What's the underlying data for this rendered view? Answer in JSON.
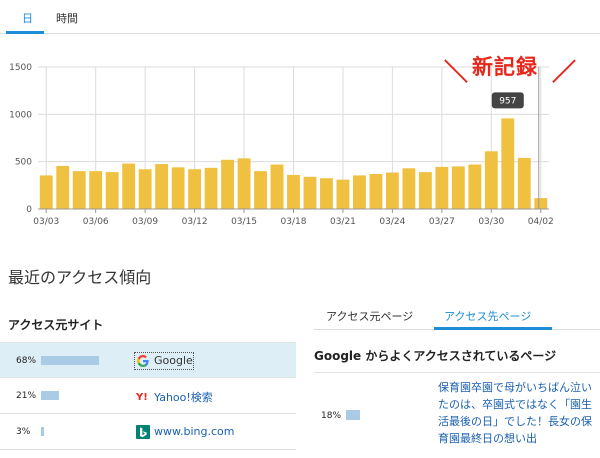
{
  "tabs": [
    {
      "label": "日",
      "active": true
    },
    {
      "label": "時間",
      "active": false
    }
  ],
  "annotation": {
    "slash_left": "＼",
    "text": "新記録",
    "slash_right": "／"
  },
  "chart_data": {
    "type": "bar",
    "categories": [
      "03/03",
      "03/04",
      "03/05",
      "03/06",
      "03/07",
      "03/08",
      "03/09",
      "03/10",
      "03/11",
      "03/12",
      "03/13",
      "03/14",
      "03/15",
      "03/16",
      "03/17",
      "03/18",
      "03/19",
      "03/20",
      "03/21",
      "03/22",
      "03/23",
      "03/24",
      "03/25",
      "03/26",
      "03/27",
      "03/28",
      "03/29",
      "03/30",
      "03/31",
      "04/01",
      "04/02"
    ],
    "values": [
      355,
      455,
      400,
      400,
      390,
      480,
      420,
      475,
      440,
      420,
      435,
      520,
      535,
      400,
      470,
      360,
      340,
      325,
      310,
      355,
      370,
      385,
      430,
      390,
      445,
      450,
      470,
      610,
      957,
      540,
      115
    ],
    "x_tick_labels": [
      "03/03",
      "03/06",
      "03/09",
      "03/12",
      "03/15",
      "03/18",
      "03/21",
      "03/24",
      "03/27",
      "03/30",
      "04/02"
    ],
    "y_tick_labels": [
      "0",
      "500",
      "1000",
      "1500"
    ],
    "ylim": [
      0,
      1500
    ],
    "tooltip": {
      "label": "957",
      "index": 28
    },
    "grid": true,
    "color": "#f0c040"
  },
  "section_title": "最近のアクセス傾向",
  "sources": {
    "heading": "アクセス元サイト",
    "rows": [
      {
        "pct": "68%",
        "fraction": 0.68,
        "icon": "google-icon",
        "label": "Google",
        "selected": true
      },
      {
        "pct": "21%",
        "fraction": 0.21,
        "icon": "yahoo-icon",
        "label": "Yahoo!検索",
        "selected": false
      },
      {
        "pct": "3%",
        "fraction": 0.03,
        "icon": "bing-icon",
        "label": "www.bing.com",
        "selected": false
      }
    ]
  },
  "right_tabs": [
    {
      "label": "アクセス元ページ",
      "active": false
    },
    {
      "label": "アクセス先ページ",
      "active": true
    }
  ],
  "pages_heading": "Google からよくアクセスされているページ",
  "pages": [
    {
      "pct": "18%",
      "fraction": 0.18,
      "title_lines": [
        "保育園卒園で母がいちばん泣い",
        "たのは、卒園式ではなく「園生",
        "活最後の日」でした！長女の保",
        "育園最終日の想い出"
      ]
    }
  ],
  "colors": {
    "accent": "#1f8dd6",
    "bar": "#f0c040",
    "annotation": "#e8271c",
    "pct_bar": "#a9cbe6"
  }
}
